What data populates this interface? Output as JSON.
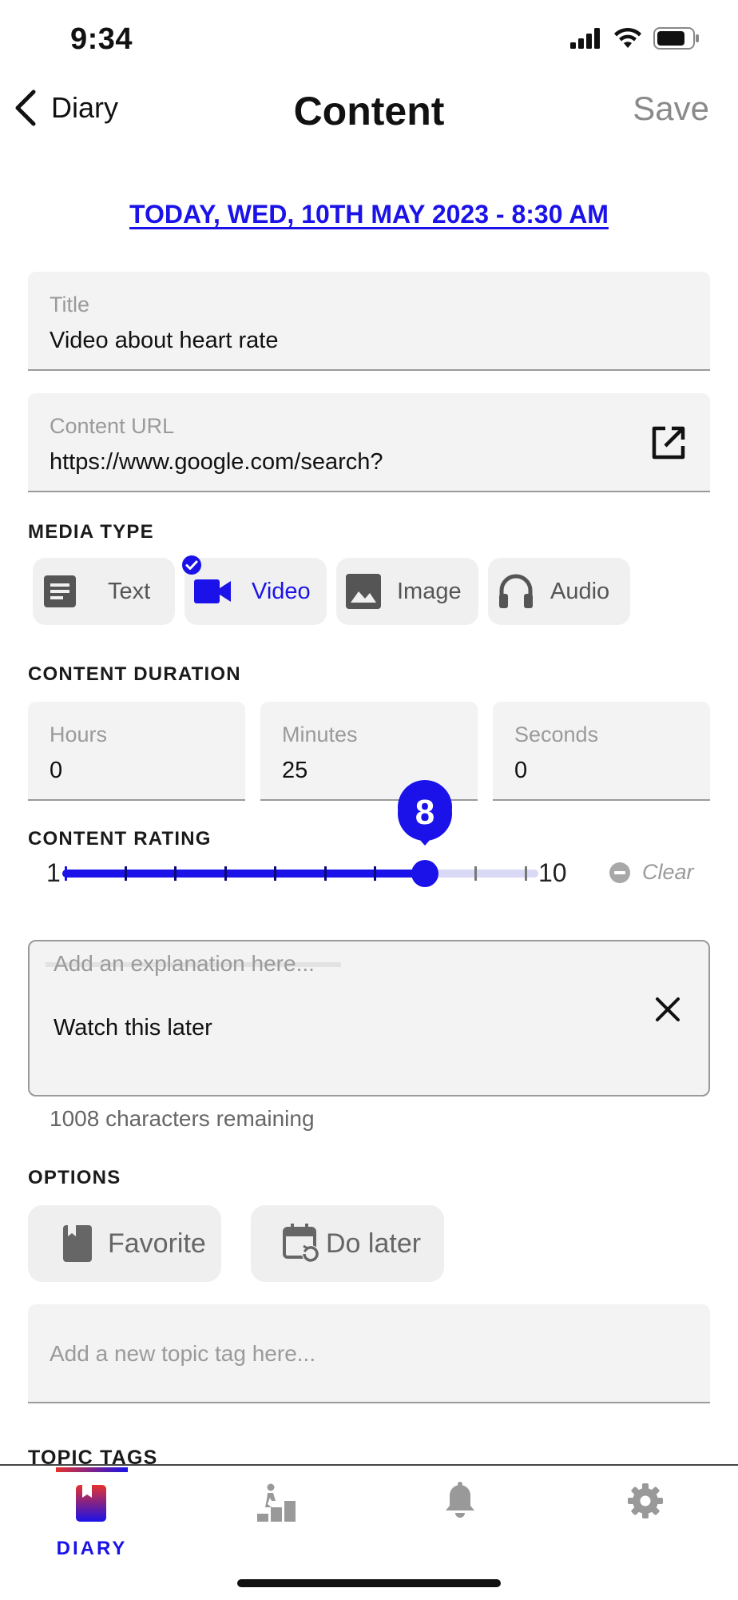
{
  "status": {
    "time": "9:34"
  },
  "nav": {
    "back_label": "Diary",
    "title": "Content",
    "save_label": "Save"
  },
  "date_link": "TODAY, WED, 10TH MAY 2023 - 8:30 AM",
  "title_field": {
    "label": "Title",
    "value": "Video about heart rate"
  },
  "url_field": {
    "label": "Content URL",
    "value": "https://www.google.com/search?"
  },
  "media_type": {
    "heading": "MEDIA TYPE",
    "options": [
      {
        "label": "Text",
        "icon": "article-icon",
        "selected": false
      },
      {
        "label": "Video",
        "icon": "videocam-icon",
        "selected": true
      },
      {
        "label": "Image",
        "icon": "image-icon",
        "selected": false
      },
      {
        "label": "Audio",
        "icon": "headphones-icon",
        "selected": false
      }
    ]
  },
  "duration": {
    "heading": "CONTENT DURATION",
    "hours": {
      "label": "Hours",
      "value": "0"
    },
    "minutes": {
      "label": "Minutes",
      "value": "25"
    },
    "seconds": {
      "label": "Seconds",
      "value": "0"
    }
  },
  "rating": {
    "heading": "CONTENT RATING",
    "min_label": "1",
    "max_label": "10",
    "value": "8",
    "clear_label": "Clear"
  },
  "explanation": {
    "placeholder": "Add an explanation here...",
    "value": "Watch this later",
    "remaining": "1008 characters remaining"
  },
  "options": {
    "heading": "OPTIONS",
    "favorite_label": "Favorite",
    "do_later_label": "Do later"
  },
  "topic_input": {
    "placeholder": "Add a new topic tag here..."
  },
  "topic_tags": {
    "heading": "TOPIC TAGS"
  },
  "tabbar": {
    "diary_label": "DIARY",
    "accent": "#1a12e8"
  },
  "colors": {
    "accent": "#1a12e8",
    "slider_track": "#d9d8f5"
  }
}
